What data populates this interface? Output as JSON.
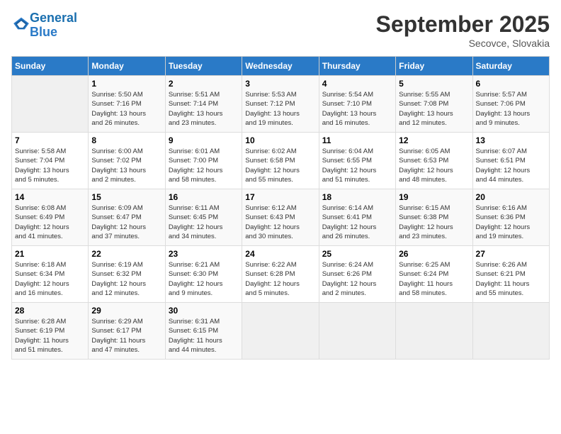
{
  "header": {
    "logo_line1": "General",
    "logo_line2": "Blue",
    "month_title": "September 2025",
    "subtitle": "Secovce, Slovakia"
  },
  "weekdays": [
    "Sunday",
    "Monday",
    "Tuesday",
    "Wednesday",
    "Thursday",
    "Friday",
    "Saturday"
  ],
  "weeks": [
    [
      {
        "day": "",
        "info": ""
      },
      {
        "day": "1",
        "info": "Sunrise: 5:50 AM\nSunset: 7:16 PM\nDaylight: 13 hours\nand 26 minutes."
      },
      {
        "day": "2",
        "info": "Sunrise: 5:51 AM\nSunset: 7:14 PM\nDaylight: 13 hours\nand 23 minutes."
      },
      {
        "day": "3",
        "info": "Sunrise: 5:53 AM\nSunset: 7:12 PM\nDaylight: 13 hours\nand 19 minutes."
      },
      {
        "day": "4",
        "info": "Sunrise: 5:54 AM\nSunset: 7:10 PM\nDaylight: 13 hours\nand 16 minutes."
      },
      {
        "day": "5",
        "info": "Sunrise: 5:55 AM\nSunset: 7:08 PM\nDaylight: 13 hours\nand 12 minutes."
      },
      {
        "day": "6",
        "info": "Sunrise: 5:57 AM\nSunset: 7:06 PM\nDaylight: 13 hours\nand 9 minutes."
      }
    ],
    [
      {
        "day": "7",
        "info": "Sunrise: 5:58 AM\nSunset: 7:04 PM\nDaylight: 13 hours\nand 5 minutes."
      },
      {
        "day": "8",
        "info": "Sunrise: 6:00 AM\nSunset: 7:02 PM\nDaylight: 13 hours\nand 2 minutes."
      },
      {
        "day": "9",
        "info": "Sunrise: 6:01 AM\nSunset: 7:00 PM\nDaylight: 12 hours\nand 58 minutes."
      },
      {
        "day": "10",
        "info": "Sunrise: 6:02 AM\nSunset: 6:58 PM\nDaylight: 12 hours\nand 55 minutes."
      },
      {
        "day": "11",
        "info": "Sunrise: 6:04 AM\nSunset: 6:55 PM\nDaylight: 12 hours\nand 51 minutes."
      },
      {
        "day": "12",
        "info": "Sunrise: 6:05 AM\nSunset: 6:53 PM\nDaylight: 12 hours\nand 48 minutes."
      },
      {
        "day": "13",
        "info": "Sunrise: 6:07 AM\nSunset: 6:51 PM\nDaylight: 12 hours\nand 44 minutes."
      }
    ],
    [
      {
        "day": "14",
        "info": "Sunrise: 6:08 AM\nSunset: 6:49 PM\nDaylight: 12 hours\nand 41 minutes."
      },
      {
        "day": "15",
        "info": "Sunrise: 6:09 AM\nSunset: 6:47 PM\nDaylight: 12 hours\nand 37 minutes."
      },
      {
        "day": "16",
        "info": "Sunrise: 6:11 AM\nSunset: 6:45 PM\nDaylight: 12 hours\nand 34 minutes."
      },
      {
        "day": "17",
        "info": "Sunrise: 6:12 AM\nSunset: 6:43 PM\nDaylight: 12 hours\nand 30 minutes."
      },
      {
        "day": "18",
        "info": "Sunrise: 6:14 AM\nSunset: 6:41 PM\nDaylight: 12 hours\nand 26 minutes."
      },
      {
        "day": "19",
        "info": "Sunrise: 6:15 AM\nSunset: 6:38 PM\nDaylight: 12 hours\nand 23 minutes."
      },
      {
        "day": "20",
        "info": "Sunrise: 6:16 AM\nSunset: 6:36 PM\nDaylight: 12 hours\nand 19 minutes."
      }
    ],
    [
      {
        "day": "21",
        "info": "Sunrise: 6:18 AM\nSunset: 6:34 PM\nDaylight: 12 hours\nand 16 minutes."
      },
      {
        "day": "22",
        "info": "Sunrise: 6:19 AM\nSunset: 6:32 PM\nDaylight: 12 hours\nand 12 minutes."
      },
      {
        "day": "23",
        "info": "Sunrise: 6:21 AM\nSunset: 6:30 PM\nDaylight: 12 hours\nand 9 minutes."
      },
      {
        "day": "24",
        "info": "Sunrise: 6:22 AM\nSunset: 6:28 PM\nDaylight: 12 hours\nand 5 minutes."
      },
      {
        "day": "25",
        "info": "Sunrise: 6:24 AM\nSunset: 6:26 PM\nDaylight: 12 hours\nand 2 minutes."
      },
      {
        "day": "26",
        "info": "Sunrise: 6:25 AM\nSunset: 6:24 PM\nDaylight: 11 hours\nand 58 minutes."
      },
      {
        "day": "27",
        "info": "Sunrise: 6:26 AM\nSunset: 6:21 PM\nDaylight: 11 hours\nand 55 minutes."
      }
    ],
    [
      {
        "day": "28",
        "info": "Sunrise: 6:28 AM\nSunset: 6:19 PM\nDaylight: 11 hours\nand 51 minutes."
      },
      {
        "day": "29",
        "info": "Sunrise: 6:29 AM\nSunset: 6:17 PM\nDaylight: 11 hours\nand 47 minutes."
      },
      {
        "day": "30",
        "info": "Sunrise: 6:31 AM\nSunset: 6:15 PM\nDaylight: 11 hours\nand 44 minutes."
      },
      {
        "day": "",
        "info": ""
      },
      {
        "day": "",
        "info": ""
      },
      {
        "day": "",
        "info": ""
      },
      {
        "day": "",
        "info": ""
      }
    ]
  ]
}
